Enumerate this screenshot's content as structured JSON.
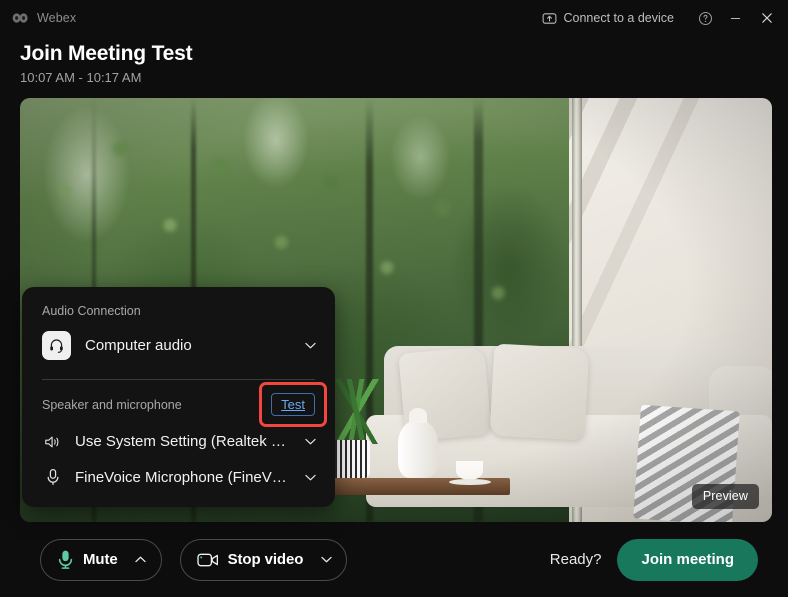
{
  "titlebar": {
    "brand": "Webex",
    "brand_logo_icon": "webex-logo-icon",
    "connect_device_label": "Connect to a device",
    "connect_device_icon": "cast-device-icon",
    "help_icon": "help-circle-icon",
    "minimize_icon": "minimize-icon",
    "close_icon": "close-icon"
  },
  "meeting": {
    "title": "Join Meeting Test",
    "time_range": "10:07 AM - 10:17 AM"
  },
  "video": {
    "preview_badge": "Preview",
    "background_description": "virtual-background-forest-and-living-room"
  },
  "audio_panel": {
    "section_label": "Audio Connection",
    "connection": {
      "icon": "headset-icon",
      "label": "Computer audio",
      "chevron_icon": "chevron-down-icon"
    },
    "speaker_mic_label": "Speaker and microphone",
    "test_label": "Test",
    "devices": [
      {
        "icon": "speaker-icon",
        "label": "Use System Setting (Realtek …",
        "chevron_icon": "chevron-down-icon"
      },
      {
        "icon": "microphone-icon",
        "label": "FineVoice Microphone (FineV…",
        "chevron_icon": "chevron-down-icon"
      }
    ]
  },
  "controls": {
    "mute": {
      "label": "Mute",
      "icon": "microphone-icon",
      "caret_icon": "chevron-up-icon"
    },
    "video": {
      "label": "Stop video",
      "icon": "camera-icon",
      "caret_icon": "chevron-down-icon"
    },
    "ready_text": "Ready?",
    "join_label": "Join meeting"
  },
  "colors": {
    "accent_green": "#17785c",
    "mic_green": "#5fc9a4",
    "link_blue": "#6aa8f0",
    "annotation_red": "#f2473f",
    "panel_bg": "#131313",
    "window_bg": "#0d0d0d"
  }
}
